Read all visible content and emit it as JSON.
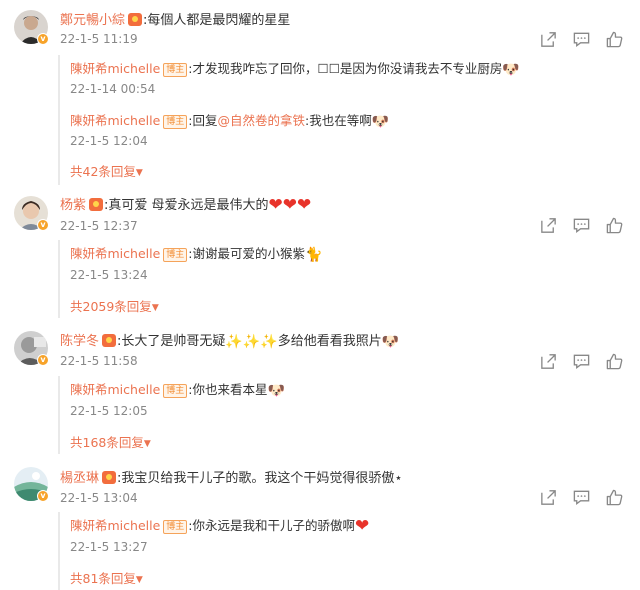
{
  "comments": [
    {
      "user": "鄭元暢小綜",
      "text": ":每個人都是最閃耀的星星",
      "time": "22-1-5 11:19",
      "replies": [
        {
          "user": "陳妍希michelle",
          "tag": "博主",
          "text": ":才发现我咋忘了回你，☐☐是因为你没请我去不专业厨房",
          "time": "22-1-14 00:54"
        },
        {
          "user": "陳妍希michelle",
          "tag": "博主",
          "prefix": ":回复",
          "mention": "@自然卷的拿铁",
          "text": ":我也在等啊",
          "time": "22-1-5 12:04"
        }
      ],
      "more": "共42条回复"
    },
    {
      "user": "杨紫",
      "text": ":真可爱 母爱永远是最伟大的",
      "time": "22-1-5 12:37",
      "replies": [
        {
          "user": "陳妍希michelle",
          "tag": "博主",
          "text": ":谢谢最可爱的小猴紫",
          "time": "22-1-5 13:24"
        }
      ],
      "more": "共2059条回复"
    },
    {
      "user": "陈学冬",
      "text": ":长大了是帅哥无疑",
      "text2": "多给他看看我照片",
      "time": "22-1-5 11:58",
      "replies": [
        {
          "user": "陳妍希michelle",
          "tag": "博主",
          "text": ":你也来看本星",
          "time": "22-1-5 12:05"
        }
      ],
      "more": "共168条回复"
    },
    {
      "user": "楊丞琳",
      "text": ":我宝贝给我干儿子的歌。我这个干妈觉得很骄傲⋆",
      "time": "22-1-5 13:04",
      "replies": [
        {
          "user": "陳妍希michelle",
          "tag": "博主",
          "text": ":你永远是我和干儿子的骄傲啊",
          "time": "22-1-5 13:27"
        }
      ],
      "more": "共81条回复"
    }
  ],
  "icons": [
    "share-icon",
    "comment-icon",
    "like-icon",
    "verified-badge-icon",
    "medal-icon",
    "heart-emoji",
    "doge-emoji",
    "cat-emoji"
  ],
  "colors": {
    "name": "#eb7350",
    "text": "#333333",
    "time": "#888888",
    "badge": "#f7a32a",
    "heart": "#e8332a"
  }
}
